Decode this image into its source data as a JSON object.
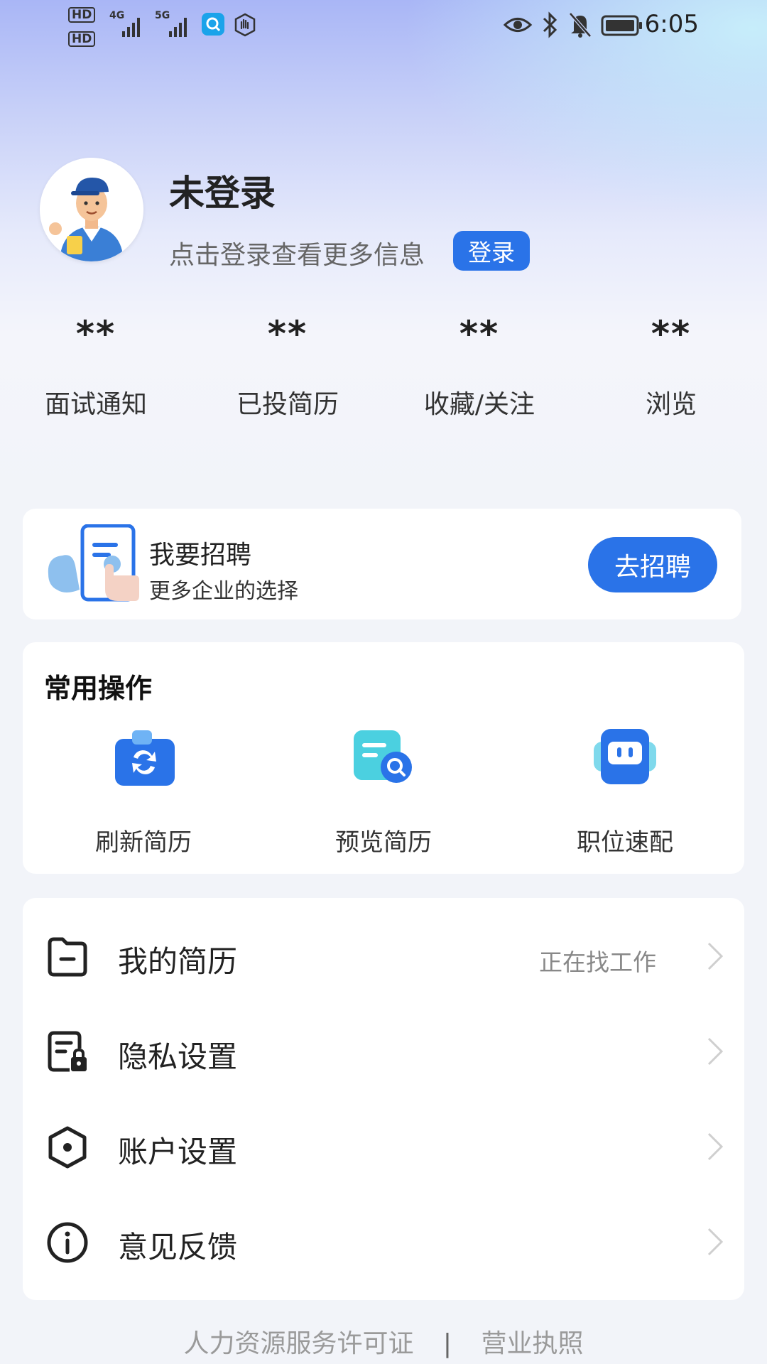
{
  "status_bar": {
    "time": "6:05",
    "hd1": "HD",
    "hd2": "HD",
    "net1": "4G",
    "net2": "5G"
  },
  "profile": {
    "username": "未登录",
    "hint": "点击登录查看更多信息",
    "login_label": "登录"
  },
  "stats": [
    {
      "value": "**",
      "label": "面试通知"
    },
    {
      "value": "**",
      "label": "已投简历"
    },
    {
      "value": "**",
      "label": "收藏/关注"
    },
    {
      "value": "**",
      "label": "浏览"
    }
  ],
  "recruit": {
    "title": "我要招聘",
    "subtitle": "更多企业的选择",
    "button": "去招聘"
  },
  "common_ops": {
    "title": "常用操作",
    "items": [
      {
        "label": "刷新简历",
        "icon": "refresh-resume-icon"
      },
      {
        "label": "预览简历",
        "icon": "preview-resume-icon"
      },
      {
        "label": "职位速配",
        "icon": "job-match-icon"
      }
    ]
  },
  "menu": [
    {
      "label": "我的简历",
      "status": "正在找工作",
      "icon": "folder-icon"
    },
    {
      "label": "隐私设置",
      "status": "",
      "icon": "privacy-lock-icon"
    },
    {
      "label": "账户设置",
      "status": "",
      "icon": "hexagon-settings-icon"
    },
    {
      "label": "意见反馈",
      "status": "",
      "icon": "info-icon"
    }
  ],
  "footer": {
    "license": "人力资源服务许可证",
    "separator": "|",
    "business": "营业执照"
  },
  "colors": {
    "accent": "#2a73e8",
    "card_bg": "#ffffff",
    "page_bg": "#f2f4f9"
  }
}
